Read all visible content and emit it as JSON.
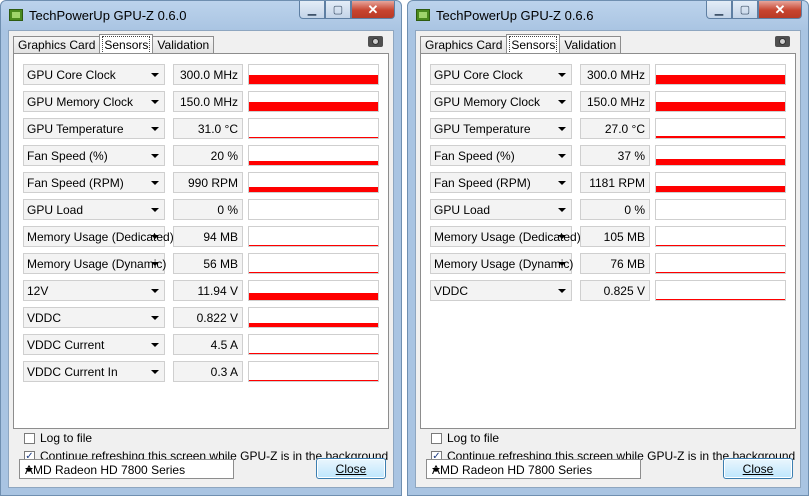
{
  "windows": [
    {
      "title": "TechPowerUp GPU-Z 0.6.0",
      "tabs": [
        "Graphics Card",
        "Sensors",
        "Validation"
      ],
      "active_tab": 1,
      "sensors": [
        {
          "name": "GPU Core Clock",
          "value": "300.0 MHz",
          "level": 0.45
        },
        {
          "name": "GPU Memory Clock",
          "value": "150.0 MHz",
          "level": 0.45
        },
        {
          "name": "GPU Temperature",
          "value": "31.0 °C",
          "level": 0.05
        },
        {
          "name": "Fan Speed (%)",
          "value": "20 %",
          "level": 0.2
        },
        {
          "name": "Fan Speed (RPM)",
          "value": "990 RPM",
          "level": 0.25
        },
        {
          "name": "GPU Load",
          "value": "0 %",
          "level": 0
        },
        {
          "name": "Memory Usage (Dedicated)",
          "value": "94 MB",
          "level": 0.05
        },
        {
          "name": "Memory Usage (Dynamic)",
          "value": "56 MB",
          "level": 0.05
        },
        {
          "name": "12V",
          "value": "11.94 V",
          "level": 0.35
        },
        {
          "name": "VDDC",
          "value": "0.822 V",
          "level": 0.2
        },
        {
          "name": "VDDC Current",
          "value": "4.5 A",
          "level": 0.05
        },
        {
          "name": "VDDC Current In",
          "value": "0.3 A",
          "level": 0.05
        }
      ],
      "log_label": "Log to file",
      "log_checked": false,
      "refresh_label": "Continue refreshing this screen while GPU-Z is in the background",
      "refresh_checked": true,
      "gpu_select": "AMD Radeon HD 7800 Series",
      "close_label": "Close"
    },
    {
      "title": "TechPowerUp GPU-Z 0.6.6",
      "tabs": [
        "Graphics Card",
        "Sensors",
        "Validation"
      ],
      "active_tab": 1,
      "sensors": [
        {
          "name": "GPU Core Clock",
          "value": "300.0 MHz",
          "level": 0.45
        },
        {
          "name": "GPU Memory Clock",
          "value": "150.0 MHz",
          "level": 0.45
        },
        {
          "name": "GPU Temperature",
          "value": "27.0 °C",
          "level": 0.1
        },
        {
          "name": "Fan Speed (%)",
          "value": "37 %",
          "level": 0.3
        },
        {
          "name": "Fan Speed (RPM)",
          "value": "1181 RPM",
          "level": 0.3
        },
        {
          "name": "GPU Load",
          "value": "0 %",
          "level": 0
        },
        {
          "name": "Memory Usage (Dedicated)",
          "value": "105 MB",
          "level": 0.05
        },
        {
          "name": "Memory Usage (Dynamic)",
          "value": "76 MB",
          "level": 0.05
        },
        {
          "name": "VDDC",
          "value": "0.825 V",
          "level": 0.05
        }
      ],
      "log_label": "Log to file",
      "log_checked": false,
      "refresh_label": "Continue refreshing this screen while GPU-Z is in the background",
      "refresh_checked": true,
      "gpu_select": "AMD Radeon HD 7800 Series",
      "close_label": "Close"
    }
  ],
  "icons": {
    "app": "gpu-z-app-icon",
    "camera": "camera-icon",
    "minimize": "minimize-icon",
    "maximize": "maximize-icon",
    "close": "close-icon",
    "dropdown": "chevron-down-icon",
    "check": "checkmark-icon"
  },
  "colors": {
    "graph_fill": "#ff0000",
    "title_bar": "#a9c4e2"
  }
}
